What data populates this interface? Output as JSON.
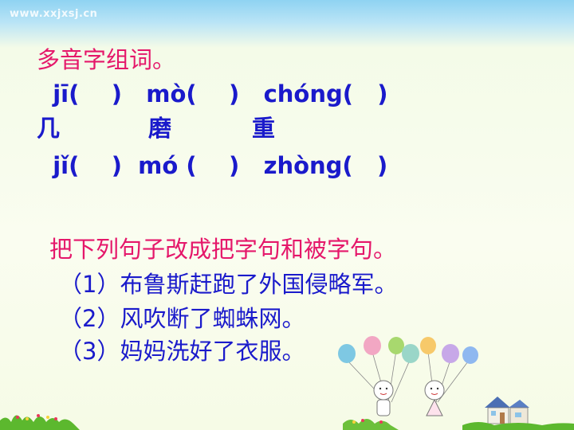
{
  "watermark": "www.xxjxsj.cn",
  "section1": {
    "title": "多音字组词。",
    "row1": "  jī(    )   mò(    )   chóng(   )",
    "row2": "几           磨          重",
    "row3": "  jǐ(    )  mó (    )   zhòng(   )"
  },
  "section2": {
    "title": "把下列句子改成把字句和被字句。",
    "items": [
      "（1）布鲁斯赶跑了外国侵略军。",
      "（2）风吹断了蜘蛛网。",
      "（3）妈妈洗好了衣服。"
    ]
  },
  "decor": {
    "balloon_colors": [
      "#7ec8e3",
      "#f2a7c3",
      "#a8d86e",
      "#f7c96a",
      "#9ad6c8",
      "#c7a8e8",
      "#f4e27a",
      "#8fb8f0"
    ],
    "grass_color": "#5cb82e"
  }
}
